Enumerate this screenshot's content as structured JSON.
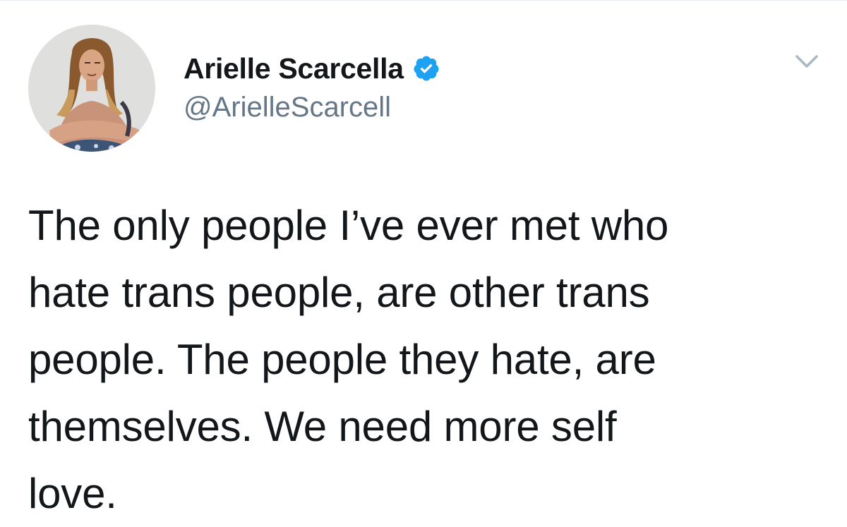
{
  "tweet": {
    "author": {
      "display_name": "Arielle Scarcella",
      "handle": "@ArielleScarcell",
      "verified": true,
      "avatar_icon": "profile-photo",
      "verified_icon": "verified-badge-icon"
    },
    "menu_icon": "chevron-down-icon",
    "text": "The only people I’ve ever met who\nhate trans people, are other trans\npeople. The people they hate, are\nthemselves. We need more self\nlove."
  },
  "colors": {
    "text": "#14171a",
    "handle": "#657786",
    "verified_blue": "#1da1f2",
    "caret": "#aab8c2",
    "background": "#ffffff"
  }
}
